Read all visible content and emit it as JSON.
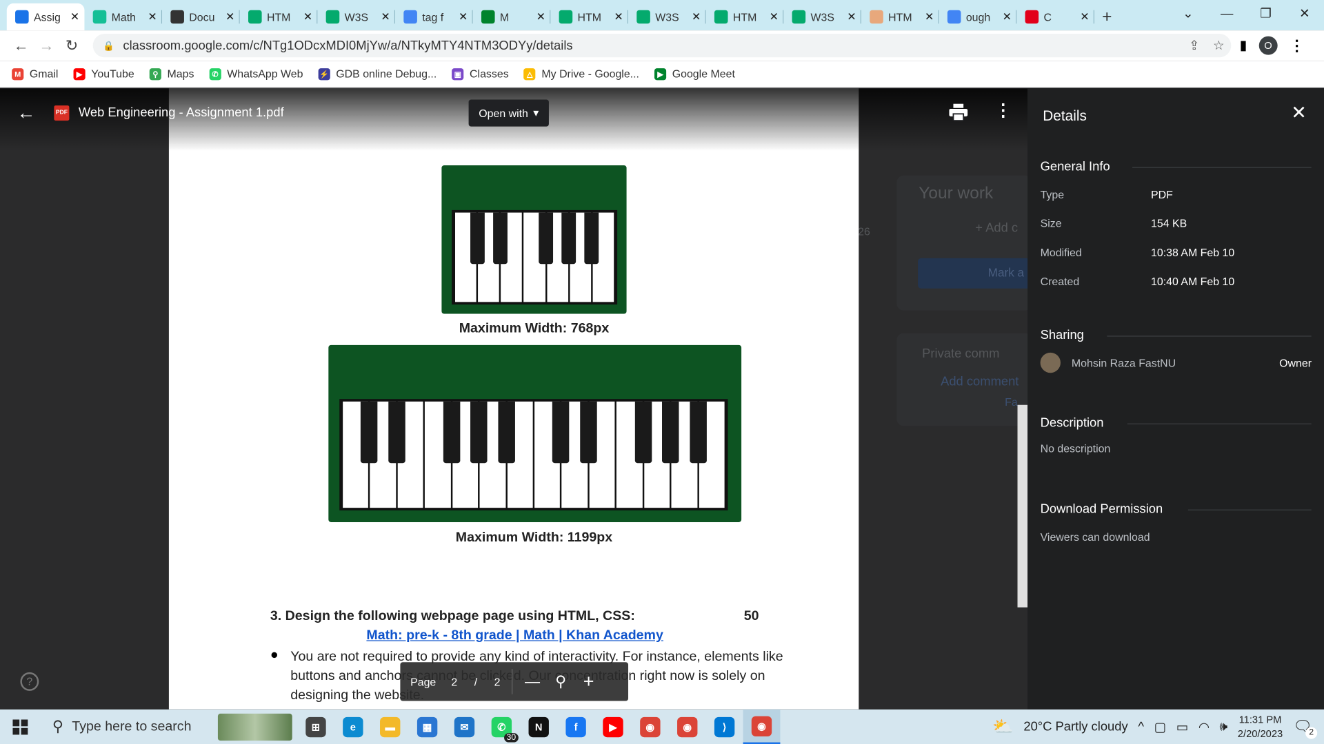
{
  "browser": {
    "tabs": [
      {
        "label": "Assig",
        "icon": "classroom-icon",
        "color": "#1a73e8",
        "active": true
      },
      {
        "label": "Math",
        "icon": "khan-icon",
        "color": "#14bf96"
      },
      {
        "label": "Docu",
        "icon": "globe-icon",
        "color": "#333333"
      },
      {
        "label": "HTM",
        "icon": "w3schools-icon",
        "color": "#04aa6d"
      },
      {
        "label": "W3S",
        "icon": "w3schools-icon",
        "color": "#04aa6d"
      },
      {
        "label": "tag f",
        "icon": "google-icon",
        "color": "#4285f4"
      },
      {
        "label": "M",
        "icon": "meet-icon",
        "color": "#00832d"
      },
      {
        "label": "HTM",
        "icon": "w3schools-icon",
        "color": "#04aa6d"
      },
      {
        "label": "W3S",
        "icon": "w3schools-icon",
        "color": "#04aa6d"
      },
      {
        "label": "HTM",
        "icon": "w3schools-icon",
        "color": "#04aa6d"
      },
      {
        "label": "W3S",
        "icon": "w3schools-icon",
        "color": "#04aa6d"
      },
      {
        "label": "HTM",
        "icon": "feather-icon",
        "color": "#e8a87c"
      },
      {
        "label": "ough",
        "icon": "google-icon",
        "color": "#4285f4"
      },
      {
        "label": "C",
        "icon": "opera-icon",
        "color": "#e2001a"
      }
    ],
    "url": "classroom.google.com/c/NTg1ODcxMDI0MjYw/a/NTkyMTY4NTM3ODYy/details",
    "profile_initial": "O",
    "bookmarks": [
      {
        "label": "Gmail",
        "icon": "gmail-icon",
        "color": "#ea4335",
        "glyph": "M"
      },
      {
        "label": "YouTube",
        "icon": "youtube-icon",
        "color": "#ff0000",
        "glyph": "▶"
      },
      {
        "label": "Maps",
        "icon": "maps-icon",
        "color": "#34a853",
        "glyph": "⚲"
      },
      {
        "label": "WhatsApp Web",
        "icon": "whatsapp-icon",
        "color": "#25d366",
        "glyph": "✆"
      },
      {
        "label": "GDB online Debug...",
        "icon": "gdb-icon",
        "color": "#3d3d9c",
        "glyph": "⚡"
      },
      {
        "label": "Classes",
        "icon": "classroom-icon",
        "color": "#7b49c9",
        "glyph": "▣"
      },
      {
        "label": "My Drive - Google...",
        "icon": "drive-icon",
        "color": "#fbbc04",
        "glyph": "△"
      },
      {
        "label": "Google Meet",
        "icon": "meet-icon",
        "color": "#00832d",
        "glyph": "▶"
      }
    ]
  },
  "viewer": {
    "title": "Web Engineering - Assignment 1.pdf",
    "open_with": "Open with",
    "background": {
      "your_work": "Your work",
      "add": "+ Add c",
      "mark": "Mark a",
      "private": "Private comm",
      "add_comment": "Add comment",
      "fa": "Fa",
      "num": "26"
    },
    "page_label": "Page",
    "page_current": "2",
    "page_sep": "/",
    "page_total": "2",
    "help": "?"
  },
  "document": {
    "caption1": "Maximum Width: 768px",
    "caption2": "Maximum Width: 1199px",
    "question": "3.  Design the following webpage page using HTML, CSS:",
    "marks": "50",
    "link": "Math: pre-k - 8th grade | Math | Khan Academy",
    "bullet1": "You are not required to provide any kind of interactivity. For instance, elements like buttons and anchors cannot be clicked. Our concentration right now is solely on designing the website."
  },
  "details": {
    "title": "Details",
    "general_info": "General Info",
    "type_label": "Type",
    "type_value": "PDF",
    "size_label": "Size",
    "size_value": "154 KB",
    "modified_label": "Modified",
    "modified_value": "10:38 AM Feb 10",
    "created_label": "Created",
    "created_value": "10:40 AM Feb 10",
    "sharing": "Sharing",
    "owner_name": "Mohsin Raza FastNU",
    "owner_role": "Owner",
    "description": "Description",
    "description_value": "No description",
    "download_permission": "Download Permission",
    "download_value": "Viewers can download"
  },
  "taskbar": {
    "search_placeholder": "Type here to search",
    "whatsapp_badge": "30",
    "weather": "20°C  Partly cloudy",
    "time": "11:31 PM",
    "date": "2/20/2023",
    "notifications": "2",
    "icons": [
      {
        "name": "task-view-icon",
        "color": "#444444",
        "glyph": "⊞"
      },
      {
        "name": "edge-icon",
        "color": "#0c8bd1",
        "glyph": "e"
      },
      {
        "name": "file-explorer-icon",
        "color": "#f3b929",
        "glyph": "▬"
      },
      {
        "name": "store-icon",
        "color": "#2a76d2",
        "glyph": "▦"
      },
      {
        "name": "mail-icon",
        "color": "#1f74c8",
        "glyph": "✉"
      },
      {
        "name": "whatsapp-icon",
        "color": "#25d366",
        "glyph": "✆"
      },
      {
        "name": "netflix-icon",
        "color": "#111111",
        "glyph": "N"
      },
      {
        "name": "facebook-icon",
        "color": "#1877f2",
        "glyph": "f"
      },
      {
        "name": "youtube-icon",
        "color": "#ff0000",
        "glyph": "▶"
      },
      {
        "name": "chrome-icon",
        "color": "#db4437",
        "glyph": "◉"
      },
      {
        "name": "chrome-profile-icon",
        "color": "#db4437",
        "glyph": "◉"
      },
      {
        "name": "vscode-icon",
        "color": "#0078d4",
        "glyph": "⟩"
      },
      {
        "name": "chrome-active-icon",
        "color": "#db4437",
        "glyph": "◉"
      }
    ]
  },
  "colors": {
    "accent": "#1a73e8",
    "piano_green": "#0d5422",
    "link": "#1155cc"
  }
}
